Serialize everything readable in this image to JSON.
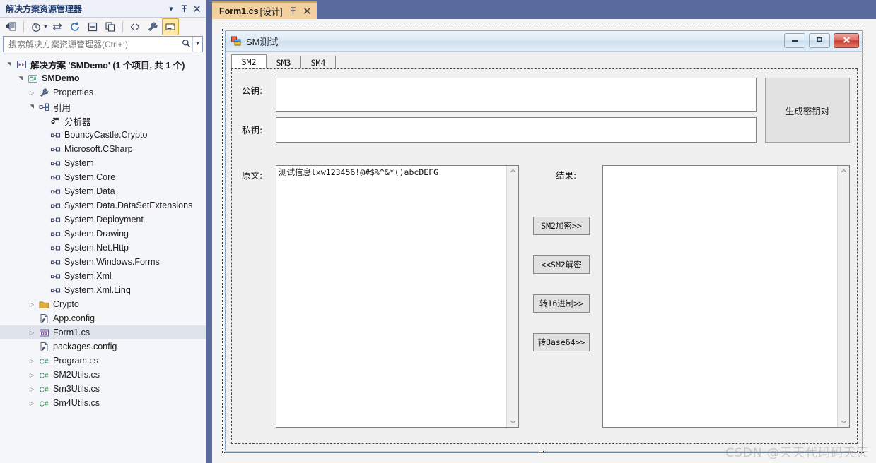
{
  "solution_explorer": {
    "title": "解决方案资源管理器",
    "titlebar_buttons": [
      {
        "name": "dropdown-icon",
        "glyph": "▾"
      },
      {
        "name": "pin-icon",
        "glyph": "⊣"
      },
      {
        "name": "close-icon",
        "glyph": "✕"
      }
    ],
    "toolbar": [
      {
        "name": "home-view-icon",
        "glyph": "⊞"
      },
      {
        "name": "pending-changes-icon",
        "glyph": "◷"
      },
      {
        "name": "sync-with-active-document-icon",
        "glyph": "⇆"
      },
      {
        "name": "refresh-icon",
        "glyph": "↻"
      },
      {
        "name": "collapse-all-icon",
        "glyph": "⊟"
      },
      {
        "name": "show-all-files-icon",
        "glyph": "❐"
      },
      {
        "name": "view-code-icon",
        "glyph": "<>"
      },
      {
        "name": "properties-icon",
        "glyph": "🔧"
      },
      {
        "name": "preview-selected-items-icon",
        "glyph": "▭"
      }
    ],
    "search_placeholder": "搜索解决方案资源管理器(Ctrl+;)",
    "tree": [
      {
        "label": "解决方案 'SMDemo' (1 个项目, 共 1 个)",
        "indent": 0,
        "expander": "▾",
        "icon": "solution-icon",
        "bold": true,
        "selected": false
      },
      {
        "label": "SMDemo",
        "indent": 1,
        "expander": "▾",
        "icon": "csharp-project-icon",
        "bold": true,
        "selected": false
      },
      {
        "label": "Properties",
        "indent": 2,
        "expander": "▸",
        "icon": "properties-wrench-icon",
        "bold": false,
        "selected": false
      },
      {
        "label": "引用",
        "indent": 2,
        "expander": "▾",
        "icon": "references-icon",
        "bold": false,
        "selected": false
      },
      {
        "label": "分析器",
        "indent": 3,
        "expander": "",
        "icon": "analyzers-icon",
        "bold": false,
        "selected": false
      },
      {
        "label": "BouncyCastle.Crypto",
        "indent": 3,
        "expander": "",
        "icon": "reference-icon",
        "bold": false,
        "selected": false
      },
      {
        "label": "Microsoft.CSharp",
        "indent": 3,
        "expander": "",
        "icon": "reference-icon",
        "bold": false,
        "selected": false
      },
      {
        "label": "System",
        "indent": 3,
        "expander": "",
        "icon": "reference-icon",
        "bold": false,
        "selected": false
      },
      {
        "label": "System.Core",
        "indent": 3,
        "expander": "",
        "icon": "reference-icon",
        "bold": false,
        "selected": false
      },
      {
        "label": "System.Data",
        "indent": 3,
        "expander": "",
        "icon": "reference-icon",
        "bold": false,
        "selected": false
      },
      {
        "label": "System.Data.DataSetExtensions",
        "indent": 3,
        "expander": "",
        "icon": "reference-icon",
        "bold": false,
        "selected": false
      },
      {
        "label": "System.Deployment",
        "indent": 3,
        "expander": "",
        "icon": "reference-icon",
        "bold": false,
        "selected": false
      },
      {
        "label": "System.Drawing",
        "indent": 3,
        "expander": "",
        "icon": "reference-icon",
        "bold": false,
        "selected": false
      },
      {
        "label": "System.Net.Http",
        "indent": 3,
        "expander": "",
        "icon": "reference-icon",
        "bold": false,
        "selected": false
      },
      {
        "label": "System.Windows.Forms",
        "indent": 3,
        "expander": "",
        "icon": "reference-icon",
        "bold": false,
        "selected": false
      },
      {
        "label": "System.Xml",
        "indent": 3,
        "expander": "",
        "icon": "reference-icon",
        "bold": false,
        "selected": false
      },
      {
        "label": "System.Xml.Linq",
        "indent": 3,
        "expander": "",
        "icon": "reference-icon",
        "bold": false,
        "selected": false
      },
      {
        "label": "Crypto",
        "indent": 2,
        "expander": "▸",
        "icon": "folder-icon",
        "bold": false,
        "selected": false
      },
      {
        "label": "App.config",
        "indent": 2,
        "expander": "",
        "icon": "config-file-icon",
        "bold": false,
        "selected": false
      },
      {
        "label": "Form1.cs",
        "indent": 2,
        "expander": "▸",
        "icon": "form-file-icon",
        "bold": false,
        "selected": true
      },
      {
        "label": "packages.config",
        "indent": 2,
        "expander": "",
        "icon": "config-file-icon",
        "bold": false,
        "selected": false
      },
      {
        "label": "Program.cs",
        "indent": 2,
        "expander": "▸",
        "icon": "csharp-file-icon",
        "bold": false,
        "selected": false
      },
      {
        "label": "SM2Utils.cs",
        "indent": 2,
        "expander": "▸",
        "icon": "csharp-file-icon",
        "bold": false,
        "selected": false
      },
      {
        "label": "Sm3Utils.cs",
        "indent": 2,
        "expander": "▸",
        "icon": "csharp-file-icon",
        "bold": false,
        "selected": false
      },
      {
        "label": "Sm4Utils.cs",
        "indent": 2,
        "expander": "▸",
        "icon": "csharp-file-icon",
        "bold": false,
        "selected": false
      }
    ]
  },
  "document_tab": {
    "name": "Form1.cs",
    "suffix": "[设计]",
    "pin_glyph": "⊣",
    "close_glyph": "✕"
  },
  "form": {
    "title": "SM测试",
    "window_buttons": [
      {
        "name": "minimize-button",
        "glyph": "▬"
      },
      {
        "name": "maximize-button",
        "glyph": "▫"
      },
      {
        "name": "close-button",
        "glyph": "✕"
      }
    ],
    "tabs": [
      {
        "label": "SM2",
        "selected": true
      },
      {
        "label": "SM3",
        "selected": false
      },
      {
        "label": "SM4",
        "selected": false
      }
    ],
    "labels": {
      "public_key": "公钥:",
      "private_key": "私钥:",
      "plaintext": "原文:",
      "result": "结果:"
    },
    "fields": {
      "public_key_value": "",
      "private_key_value": "",
      "plaintext_value": "测试信息lxw123456!@#$%^&*()abcDEFG",
      "result_value": ""
    },
    "buttons": {
      "generate_keypair": "生成密钥对",
      "sm2_encrypt": "SM2加密>>",
      "sm2_decrypt": "<<SM2解密",
      "to_hex": "转16进制>>",
      "to_base64": "转Base64>>"
    },
    "scroll_arrows": {
      "up": "⌃",
      "down": "⌄"
    }
  },
  "watermark": "CSDN @天天代码码天天"
}
